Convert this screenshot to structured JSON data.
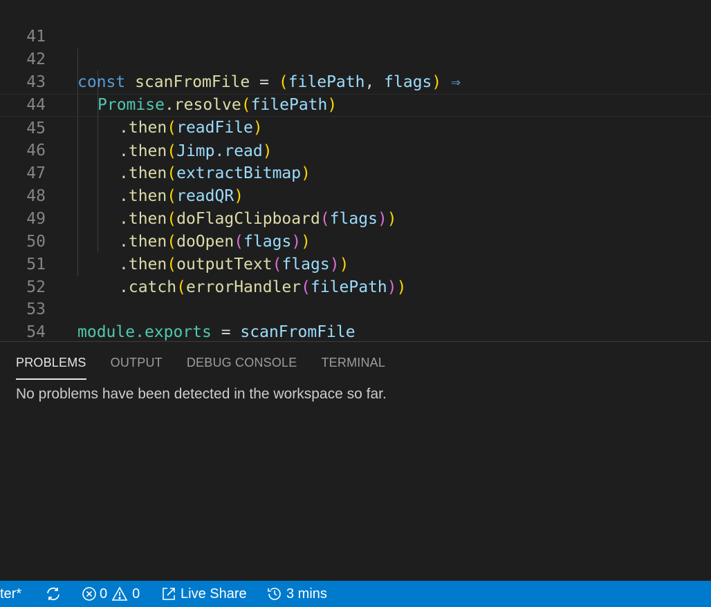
{
  "editor": {
    "line_numbers": [
      "41",
      "42",
      "43",
      "44",
      "45",
      "46",
      "47",
      "48",
      "49",
      "50",
      "51",
      "52",
      "53",
      "54"
    ],
    "tokens": {
      "l42_const": "const",
      "l42_name": "scanFromFile",
      "l42_eq": " = ",
      "l42_open": "(",
      "l42_p1": "filePath",
      "l42_comma": ", ",
      "l42_p2": "flags",
      "l42_close": ")",
      "l42_arrow": " ⇒",
      "l43_promise": "Promise",
      "l43_resolve": ".resolve",
      "l43_open": "(",
      "l43_arg": "filePath",
      "l43_close": ")",
      "then": ".then",
      "l44_arg": "readFile",
      "l45_jimp": "Jimp",
      "l45_read": ".read",
      "l46_arg": "extractBitmap",
      "l47_arg": "readQR",
      "l48_fn": "doFlagClipboard",
      "l49_fn": "doOpen",
      "l50_fn": "outputText",
      "flags": "flags",
      "l51_catch": ".catch",
      "l51_fn": "errorHandler",
      "l51_arg": "filePath",
      "l53_module": "module",
      "l53_exports": ".exports",
      "l53_eq": " = ",
      "l53_name": "scanFromFile"
    }
  },
  "panel": {
    "tabs": [
      {
        "label": "PROBLEMS",
        "active": true
      },
      {
        "label": "OUTPUT",
        "active": false
      },
      {
        "label": "DEBUG CONSOLE",
        "active": false
      },
      {
        "label": "TERMINAL",
        "active": false
      }
    ],
    "message": "No problems have been detected in the workspace so far."
  },
  "statusbar": {
    "branch": "ter*",
    "errors": "0",
    "warnings": "0",
    "live_share": "Live Share",
    "time": "3 mins",
    "icons": [
      "sync-icon",
      "error-icon",
      "warning-icon",
      "live-share-icon",
      "history-icon"
    ]
  },
  "colors": {
    "background": "#1e1e1e",
    "statusbar": "#007acc",
    "keyword": "#569cd6",
    "function": "#dcdcaa",
    "variable": "#9cdcfe",
    "class": "#4ec9b0",
    "bracket1": "#ffd700",
    "bracket2": "#da70d6",
    "bracket3": "#179fff"
  }
}
